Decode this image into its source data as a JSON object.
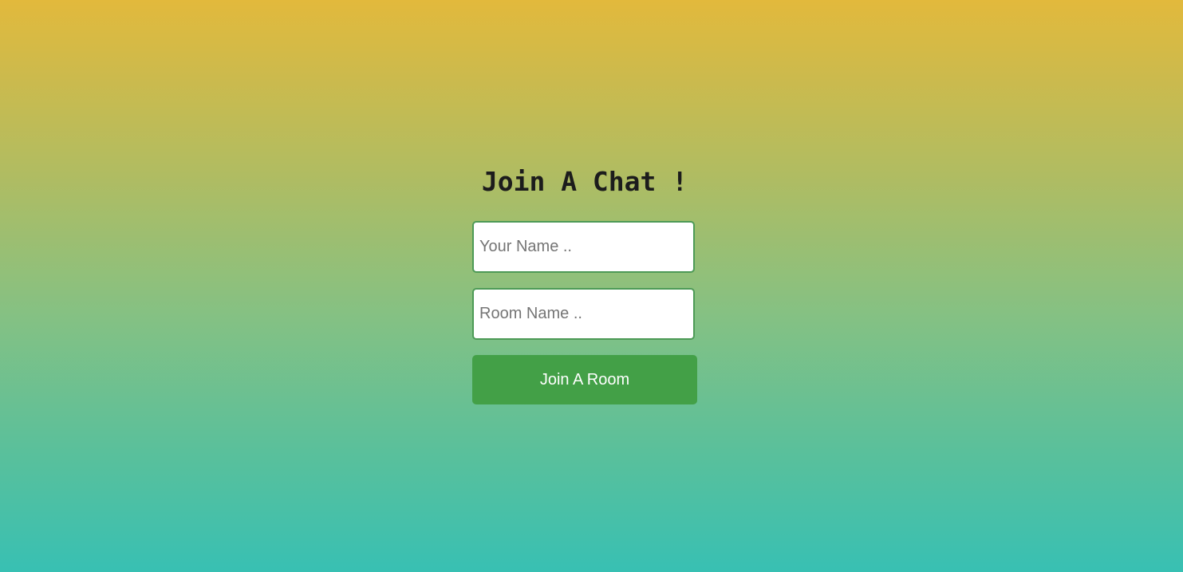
{
  "join": {
    "title": "Join A Chat !",
    "name_placeholder": "Your Name ..",
    "name_value": "",
    "room_placeholder": "Room Name ..",
    "room_value": "",
    "button_label": "Join A Room"
  },
  "colors": {
    "gradient_top": "#e2b93c",
    "gradient_bottom": "#38c0b3",
    "button": "#43a047",
    "input_border": "#4d9a56",
    "title_text": "#1c1c1c"
  }
}
